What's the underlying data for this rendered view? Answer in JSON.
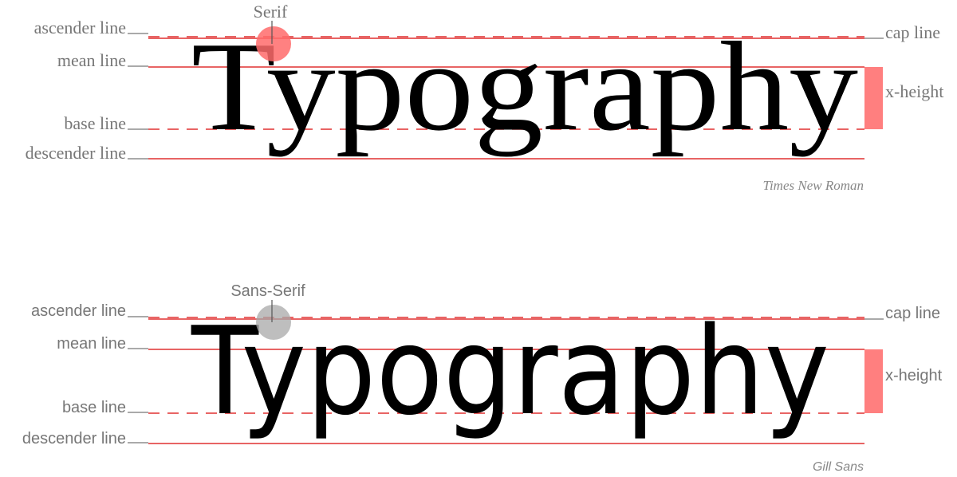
{
  "colors": {
    "guide_line": "#e03030",
    "xheight_bar": "#ff7f7f",
    "serif_marker": "#ff6b6b",
    "sans_marker": "#a8a8a8",
    "label": "#777777"
  },
  "serif_panel": {
    "callout": "Serif",
    "word": "Typography",
    "labels": {
      "ascender": "ascender line",
      "mean": "mean line",
      "base": "base line",
      "descender": "descender line",
      "cap": "cap line",
      "xheight": "x-height"
    },
    "font_caption": "Times New Roman"
  },
  "sans_panel": {
    "callout": "Sans-Serif",
    "word": "Typography",
    "labels": {
      "ascender": "ascender line",
      "mean": "mean line",
      "base": "base line",
      "descender": "descender line",
      "cap": "cap line",
      "xheight": "x-height"
    },
    "font_caption": "Gill Sans"
  }
}
